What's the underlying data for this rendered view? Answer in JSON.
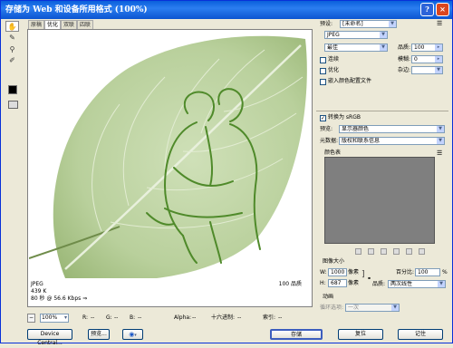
{
  "window": {
    "title": "存储为 Web 和设备所用格式 (100%)",
    "help_btn": "?",
    "close_btn": "×"
  },
  "toolbar": {
    "hand": "✋",
    "slice": "✎",
    "zoom": "⚲",
    "eyedropper": "✐"
  },
  "tabs": [
    {
      "label": "原稿"
    },
    {
      "label": "优化"
    },
    {
      "label": "双联"
    },
    {
      "label": "四联"
    }
  ],
  "preview_info": {
    "format": "JPEG",
    "size": "439 K",
    "time": "80 秒 @ 56.6 Kbps",
    "time_suffix": "⇒",
    "quality": "100 品质"
  },
  "status_bar": {
    "zoom_value": "100%",
    "r_label": "R:",
    "r_value": "--",
    "g_label": "G:",
    "g_value": "--",
    "b_label": "B:",
    "b_value": "--",
    "alpha_label": "Alpha:",
    "alpha_value": "--",
    "hex_label": "十六进制:",
    "hex_value": "--",
    "index_label": "索引:",
    "index_value": "--"
  },
  "bottom_buttons": {
    "device_central": "Device Central...",
    "preview": "预览...",
    "browser_icon": "browser-icon",
    "save": "存储",
    "reset": "复位",
    "remember": "记住"
  },
  "settings": {
    "preset_label": "预设:",
    "preset_value": "[未命名]",
    "format_value": "JPEG",
    "quality_level": "最佳",
    "quality_label": "品质:",
    "quality_value": "100",
    "progressive_label": "连续",
    "blur_label": "模糊:",
    "blur_value": "0",
    "optimized_label": "优化",
    "matte_label": "杂边:",
    "icc_label": "嵌入颜色配置文件",
    "convert_srgb_label": "转换为 sRGB",
    "preview_label": "预览:",
    "preview_value": "显示器颜色",
    "metadata_label": "元数据:",
    "metadata_value": "版权和联系信息",
    "color_table_label": "颜色表",
    "image_size_label": "图像大小",
    "w_label": "W:",
    "w_value": "1000",
    "h_label": "H:",
    "h_value": "687",
    "px_unit": "像素",
    "percent_label": "百分比:",
    "percent_value": "100",
    "percent_unit": "%",
    "resample_label": "品质:",
    "resample_value": "两次线性",
    "animation_label": "动画",
    "loop_label": "循环选项:",
    "loop_value": "一次"
  }
}
